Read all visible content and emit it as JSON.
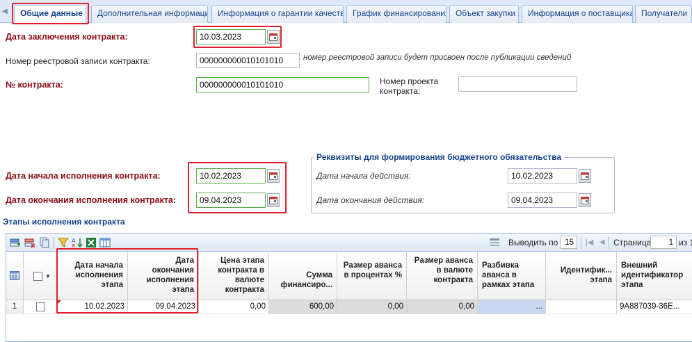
{
  "tabs": [
    {
      "label": "Общие данные",
      "active": true
    },
    {
      "label": "Дополнительная информация",
      "active": false
    },
    {
      "label": "Информация о гарантии качества",
      "active": false
    },
    {
      "label": "График финансирования",
      "active": false
    },
    {
      "label": "Объект закупки",
      "active": false
    },
    {
      "label": "Информация о поставщиках",
      "active": false
    },
    {
      "label": "Получатели",
      "active": false
    }
  ],
  "form": {
    "contract_date": {
      "label": "Дата заключения контракта:",
      "value": "10.03.2023"
    },
    "registry_number": {
      "label": "Номер реестровой записи контракта:",
      "value": "000000000010101010",
      "hint": "номер реестровой записи будет присвоен после публикации сведений"
    },
    "contract_number": {
      "label": "№ контракта:",
      "value": "000000000010101010"
    },
    "project_number": {
      "label": "Номер проекта контракта:",
      "value": ""
    },
    "start_date": {
      "label": "Дата начала исполнения контракта:",
      "value": "10.02.2023"
    },
    "end_date": {
      "label": "Дата окончания исполнения контракта:",
      "value": "09.04.2023"
    }
  },
  "budget": {
    "legend": "Реквизиты для формирования бюджетного обязательства",
    "start": {
      "label": "Дата начала действия:",
      "value": "10.02.2023"
    },
    "end": {
      "label": "Дата окончания действия:",
      "value": "09.04.2023"
    }
  },
  "stages": {
    "title": "Этапы исполнения контракта",
    "toolbar": {
      "page_size_label": "Выводить по",
      "page_size": "15",
      "page_label": "Страница",
      "page": "1",
      "of_label": "из 1"
    },
    "columns": [
      "Дата начала исполнения этапа",
      "Дата окончания исполнения этапа",
      "Цена этапа контракта в валюте контракта",
      "Сумма финансиро...",
      "Размер аванса в процентах %",
      "Размер аванса в валюте контракта",
      "Разбивка аванса в рамках этапа",
      "Идентифик... этапа",
      "Внешний идентификатор этапа"
    ],
    "rows": [
      {
        "num": "1",
        "start": "10.02.2023",
        "end": "09.04.2023",
        "price": "0,00",
        "finance": "600,00",
        "advance_pct": "0,00",
        "advance_sum": "0,00",
        "breakdown": "...",
        "ident": "",
        "ext_id": "9A887039-36E..."
      }
    ]
  },
  "colors": {
    "required_label": "#8b0d18",
    "accent": "#15428b",
    "highlight": "#e0202c",
    "valid_border": "#58b04a"
  }
}
